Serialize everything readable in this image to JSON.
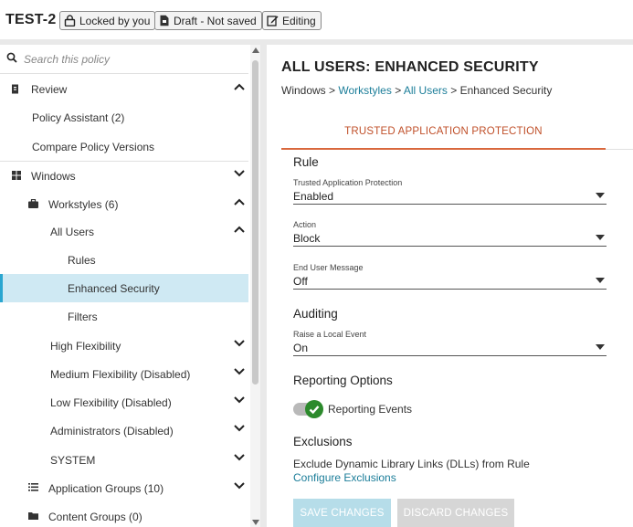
{
  "header": {
    "policy_name": "TEST-2",
    "badges": [
      {
        "label": "Locked by you",
        "icon": "lock-icon"
      },
      {
        "label": "Draft - Not saved",
        "icon": "document-icon"
      },
      {
        "label": "Editing",
        "icon": "edit-icon"
      }
    ]
  },
  "sidebar": {
    "search_placeholder": "Search this policy",
    "items": [
      {
        "label": "Review",
        "icon": "review-icon",
        "chevron": "up"
      },
      {
        "label": "Policy Assistant (2)"
      },
      {
        "label": "Compare Policy Versions"
      },
      {
        "label": "Windows",
        "icon": "windows-icon",
        "chevron": "down"
      },
      {
        "label": "Workstyles (6)",
        "icon": "briefcase-icon",
        "chevron": "up"
      },
      {
        "label": "All Users",
        "chevron": "up"
      },
      {
        "label": "Rules"
      },
      {
        "label": "Enhanced Security",
        "selected": true
      },
      {
        "label": "Filters"
      },
      {
        "label": "High Flexibility",
        "chevron": "down"
      },
      {
        "label": "Medium Flexibility (Disabled)",
        "chevron": "down"
      },
      {
        "label": "Low Flexibility (Disabled)",
        "chevron": "down"
      },
      {
        "label": "Administrators (Disabled)",
        "chevron": "down"
      },
      {
        "label": "SYSTEM",
        "chevron": "down"
      },
      {
        "label": "Application Groups (10)",
        "icon": "list-icon",
        "chevron": "down"
      },
      {
        "label": "Content Groups (0)",
        "icon": "folder-icon"
      }
    ]
  },
  "main": {
    "title": "ALL USERS: ENHANCED SECURITY",
    "breadcrumb": [
      "Windows",
      "Workstyles",
      "All Users",
      "Enhanced Security"
    ],
    "breadcrumb_sep": ">",
    "tab": "TRUSTED APPLICATION PROTECTION",
    "rule_heading": "Rule",
    "fields": {
      "tap_label": "Trusted Application Protection",
      "tap_value": "Enabled",
      "action_label": "Action",
      "action_value": "Block",
      "eum_label": "End User Message",
      "eum_value": "Off",
      "raise_label": "Raise a Local Event",
      "raise_value": "On"
    },
    "auditing_heading": "Auditing",
    "reporting_heading": "Reporting Options",
    "reporting_toggle_label": "Reporting Events",
    "reporting_enabled": true,
    "exclusions_heading": "Exclusions",
    "exclusions_text": "Exclude Dynamic Library Links (DLLs) from Rule",
    "exclusions_link": "Configure Exclusions",
    "save_button": "SAVE CHANGES",
    "discard_button": "DISCARD CHANGES"
  },
  "colors": {
    "accent_link": "#1b7d99",
    "tab_accent": "#d9683d",
    "selected_bg": "#cfe9f3",
    "selected_border": "#2aa6d0",
    "toggle_on": "#2c8a2c"
  }
}
